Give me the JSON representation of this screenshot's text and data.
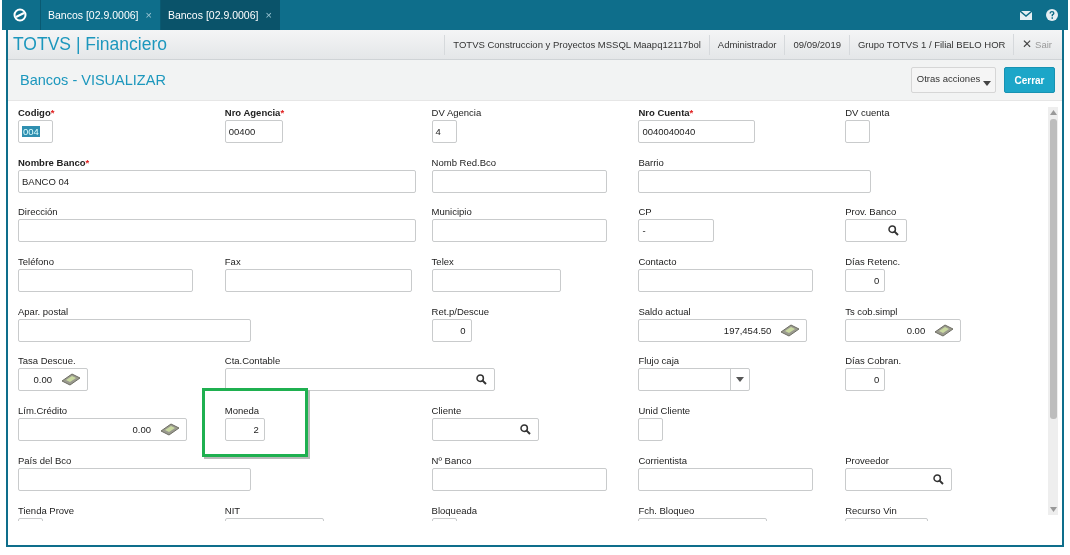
{
  "tabs": [
    {
      "label": "Bancos [02.9.0006]",
      "close": "×",
      "selected": false
    },
    {
      "label": "Bancos [02.9.0006]",
      "close": "×",
      "selected": true
    }
  ],
  "app_title": "TOTVS | Financiero",
  "session": [
    "TOTVS Construccion y Proyectos MSSQL Maapq12117bol",
    "Administrador",
    "09/09/2019",
    "Grupo TOTVS 1 / Filial BELO HOR"
  ],
  "exit": {
    "icon": "✕",
    "label": "Sair"
  },
  "page_title": "Bancos - VISUALIZAR",
  "buttons": [
    {
      "label": "Otras acciones",
      "kind": "menu"
    },
    {
      "label": "Cerrar",
      "kind": "primary"
    }
  ],
  "rows": [
    {
      "fields": [
        {
          "label": "Codigo",
          "required": true,
          "mark": "*",
          "kind": "text",
          "value": "004",
          "text_selected": true
        },
        {
          "label": "Nro Agencia",
          "required": true,
          "mark": "*",
          "kind": "text",
          "value": "00400"
        },
        {
          "label": "DV Agencia",
          "required": false,
          "kind": "text",
          "value": "4"
        },
        {
          "label": "Nro Cuenta",
          "required": true,
          "mark": "*",
          "kind": "text",
          "value": "0040040040"
        },
        {
          "label": "DV cuenta",
          "required": false,
          "kind": "text"
        }
      ]
    },
    {
      "fields": [
        {
          "label": "Nombre Banco",
          "required": true,
          "mark": "*",
          "kind": "text",
          "value": "BANCO 04"
        },
        {
          "label": "Nomb Red.Bco",
          "required": false,
          "kind": "text"
        },
        {
          "label": "Barrio",
          "required": false,
          "kind": "text"
        }
      ]
    },
    {
      "fields": [
        {
          "label": "Dirección",
          "required": false,
          "kind": "text"
        },
        {
          "label": "Municipio",
          "required": false,
          "kind": "text"
        },
        {
          "label": "CP",
          "required": false,
          "kind": "text",
          "value": "-"
        },
        {
          "label": "Prov. Banco",
          "required": false,
          "kind": "search"
        }
      ]
    },
    {
      "fields": [
        {
          "label": "Teléfono",
          "required": false,
          "kind": "text"
        },
        {
          "label": "Fax",
          "required": false,
          "kind": "text"
        },
        {
          "label": "Telex",
          "required": false,
          "kind": "text"
        },
        {
          "label": "Contacto",
          "required": false,
          "kind": "text"
        },
        {
          "label": "Días Retenc.",
          "required": false,
          "kind": "number",
          "value": "0"
        }
      ]
    },
    {
      "fields": [
        {
          "label": "Apar. postal",
          "required": false,
          "kind": "text"
        },
        {
          "label": "Ret.p/Descue",
          "required": false,
          "kind": "number",
          "value": "0"
        },
        {
          "label": "Saldo actual",
          "required": false,
          "kind": "money",
          "value": "197,454.50"
        },
        {
          "label": "Ts cob.simpl",
          "required": false,
          "kind": "money",
          "value": "0.00"
        }
      ]
    },
    {
      "fields": [
        {
          "label": "Tasa Descue.",
          "required": false,
          "kind": "money",
          "value": "0.00"
        },
        {
          "label": "Cta.Contable",
          "required": false,
          "kind": "search"
        },
        {
          "label": "Flujo caja",
          "required": false,
          "kind": "select"
        },
        {
          "label": "Días Cobran.",
          "required": false,
          "kind": "number",
          "value": "0"
        }
      ]
    },
    {
      "fields": [
        {
          "label": "Lím.Crédito",
          "required": false,
          "kind": "money",
          "value": "0.00"
        },
        {
          "label": "Moneda",
          "required": false,
          "kind": "number",
          "value": "2",
          "highlighted": true
        },
        {
          "label": "Cliente",
          "required": false,
          "kind": "search"
        },
        {
          "label": "Unid Cliente",
          "required": false,
          "kind": "text"
        }
      ]
    },
    {
      "fields": [
        {
          "label": "País del Bco",
          "required": false,
          "kind": "text"
        },
        {
          "label": "Nº Banco",
          "required": false,
          "kind": "text"
        },
        {
          "label": "Corrientista",
          "required": false,
          "kind": "text"
        },
        {
          "label": "Proveedor",
          "required": false,
          "kind": "search"
        }
      ]
    },
    {
      "fields": [
        {
          "label": "Tienda Prove",
          "required": false,
          "kind": "text"
        },
        {
          "label": "NIT",
          "required": false,
          "kind": "text"
        },
        {
          "label": "Bloqueada",
          "required": false,
          "kind": "text"
        },
        {
          "label": "Fch. Bloqueo",
          "required": false,
          "kind": "text"
        },
        {
          "label": "Recurso Vin",
          "required": false,
          "kind": "text"
        }
      ]
    }
  ]
}
